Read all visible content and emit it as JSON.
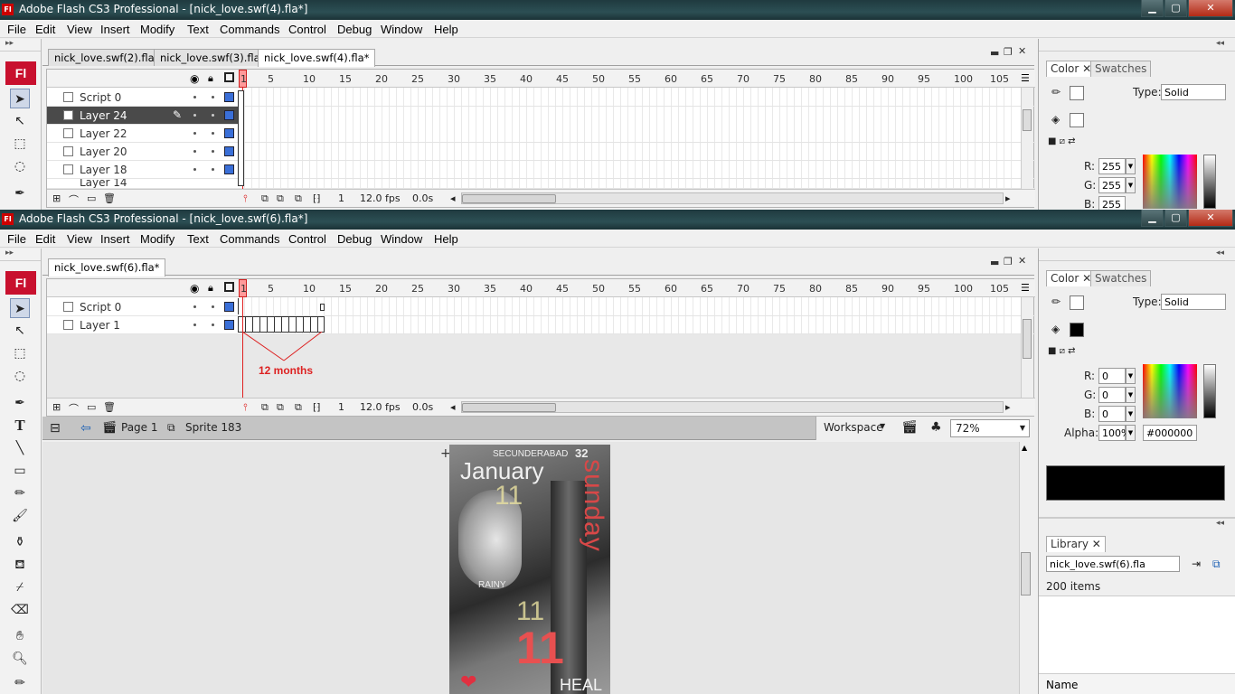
{
  "window1": {
    "title": "Adobe Flash CS3 Professional - [nick_love.swf(4).fla*]",
    "logo": "Fl",
    "menu": [
      "File",
      "Edit",
      "View",
      "Insert",
      "Modify",
      "Text",
      "Commands",
      "Control",
      "Debug",
      "Window",
      "Help"
    ],
    "tabs": [
      "nick_love.swf(2).fla*",
      "nick_love.swf(3).fla*",
      "nick_love.swf(4).fla*"
    ],
    "active_tab": 2,
    "timeline": {
      "frame_numbers": [
        "1",
        "5",
        "10",
        "15",
        "20",
        "25",
        "30",
        "35",
        "40",
        "45",
        "50",
        "55",
        "60",
        "65",
        "70",
        "75",
        "80",
        "85",
        "90",
        "95",
        "100",
        "105"
      ],
      "layers": [
        "Script 0",
        "Layer 24",
        "Layer 22",
        "Layer 20",
        "Layer 18",
        "Layer 14"
      ],
      "selected_layer": "Layer 24",
      "current_frame": "1",
      "fps": "12.0 fps",
      "time": "0.0s"
    },
    "color_panel": {
      "tabs": [
        "Color",
        "Swatches"
      ],
      "type_label": "Type:",
      "type_value": "Solid",
      "r_label": "R:",
      "r": "255",
      "g_label": "G:",
      "g": "255",
      "b_label": "B:",
      "b": "255"
    }
  },
  "window2": {
    "title": "Adobe Flash CS3 Professional - [nick_love.swf(6).fla*]",
    "logo": "Fl",
    "menu": [
      "File",
      "Edit",
      "View",
      "Insert",
      "Modify",
      "Text",
      "Commands",
      "Control",
      "Debug",
      "Window",
      "Help"
    ],
    "tabs": [
      "nick_love.swf(6).fla*"
    ],
    "timeline": {
      "frame_numbers": [
        "1",
        "5",
        "10",
        "15",
        "20",
        "25",
        "30",
        "35",
        "40",
        "45",
        "50",
        "55",
        "60",
        "65",
        "70",
        "75",
        "80",
        "85",
        "90",
        "95",
        "100",
        "105"
      ],
      "layers": [
        "Script 0",
        "Layer 1"
      ],
      "annotation": "12 months",
      "current_frame": "1",
      "fps": "12.0 fps",
      "time": "0.0s"
    },
    "edit_bar": {
      "scene": "Page 1",
      "symbol": "Sprite 183",
      "workspace": "Workspace",
      "zoom": "72%"
    },
    "artwork": {
      "location": "SECUNDERABAD",
      "number_top": "32",
      "month": "January",
      "day_name": "sunday",
      "weather": "RAINY",
      "day_number": "11",
      "bottom_text": "HEAL"
    },
    "color_panel": {
      "tabs": [
        "Color",
        "Swatches"
      ],
      "type_label": "Type:",
      "type_value": "Solid",
      "r_label": "R:",
      "r": "0",
      "g_label": "G:",
      "g": "0",
      "b_label": "B:",
      "b": "0",
      "alpha_label": "Alpha:",
      "alpha": "100%",
      "hex": "#000000"
    },
    "library": {
      "tab": "Library",
      "document": "nick_love.swf(6).fla",
      "count": "200 items",
      "column_name": "Name"
    }
  },
  "colors": {
    "accent": "#c8102e",
    "timeline_marker": "#d22020",
    "layer_color": "#3a6fd8",
    "fill_swatch": "#000000"
  }
}
